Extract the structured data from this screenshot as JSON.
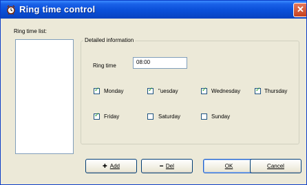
{
  "window": {
    "title": "Ring time control",
    "close_glyph": "✕"
  },
  "list": {
    "label": "Ring time list:"
  },
  "details": {
    "group_title": "Detailed information",
    "ring_time_label": "Ring time",
    "ring_time_value": "08:00"
  },
  "days": [
    {
      "label": "Monday",
      "checked": true
    },
    {
      "label": "\"uesday",
      "checked": true
    },
    {
      "label": "Wednesday",
      "checked": true
    },
    {
      "label": "Thursday",
      "checked": true
    },
    {
      "label": "Friday",
      "checked": true
    },
    {
      "label": "Saturday",
      "checked": false
    },
    {
      "label": "Sunday",
      "checked": false
    }
  ],
  "buttons": {
    "add": {
      "glyph": "✚",
      "label": "Add"
    },
    "del": {
      "glyph": "━",
      "label": "Del"
    },
    "ok": {
      "label": "OK"
    },
    "cancel": {
      "label": "Cancel"
    }
  },
  "colors": {
    "titlebar": "#0a4fd8",
    "dialog_bg": "#ece9d8",
    "check_mark": "#21a121",
    "close_button": "#c6421f"
  },
  "icons": {
    "app": "alarm-clock-icon"
  }
}
